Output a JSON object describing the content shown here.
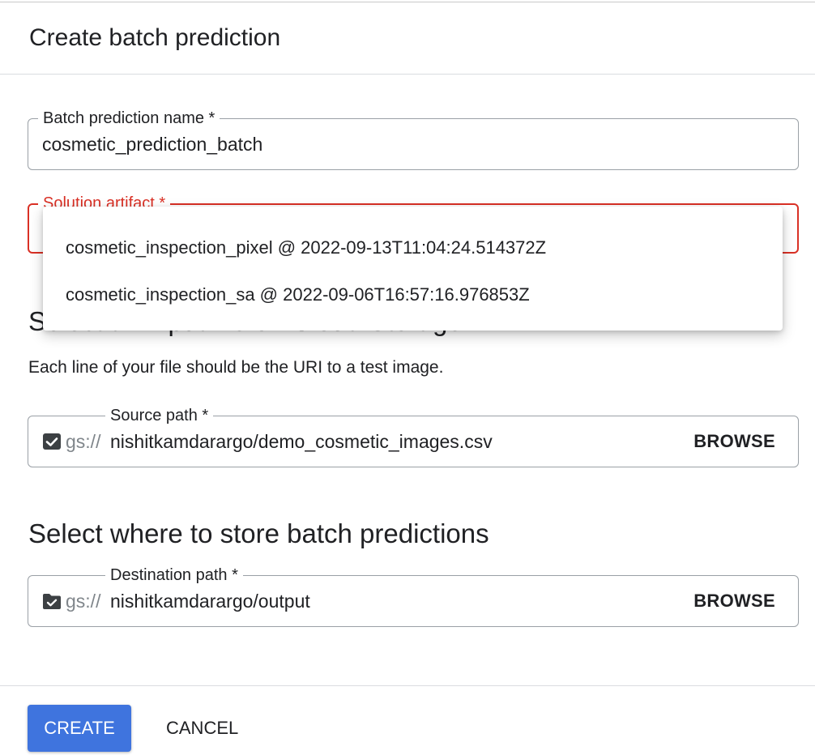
{
  "dialog": {
    "title": "Create batch prediction"
  },
  "batch_name": {
    "label": "Batch prediction name *",
    "value": "cosmetic_prediction_batch"
  },
  "solution_artifact": {
    "label": "Solution artifact *",
    "options": [
      "cosmetic_inspection_pixel @ 2022-09-13T11:04:24.514372Z",
      "cosmetic_inspection_sa @ 2022-09-06T16:57:16.976853Z"
    ],
    "error_color": "#d93025"
  },
  "input_section": {
    "heading": "Select an input file on Cloud Storage",
    "helper": "Each line of your file should be the URI to a test image."
  },
  "source_path": {
    "label": "Source path *",
    "prefix": "gs://",
    "value": "nishitkamdarargo/demo_cosmetic_images.csv",
    "browse_label": "BROWSE",
    "icon": "file-check-icon"
  },
  "store_section": {
    "heading": "Select where to store batch predictions"
  },
  "destination_path": {
    "label": "Destination path *",
    "prefix": "gs://",
    "value": "nishitkamdarargo/output",
    "browse_label": "BROWSE",
    "icon": "folder-check-icon"
  },
  "footer": {
    "create_label": "CREATE",
    "cancel_label": "CANCEL",
    "primary_color": "#3f74de"
  }
}
